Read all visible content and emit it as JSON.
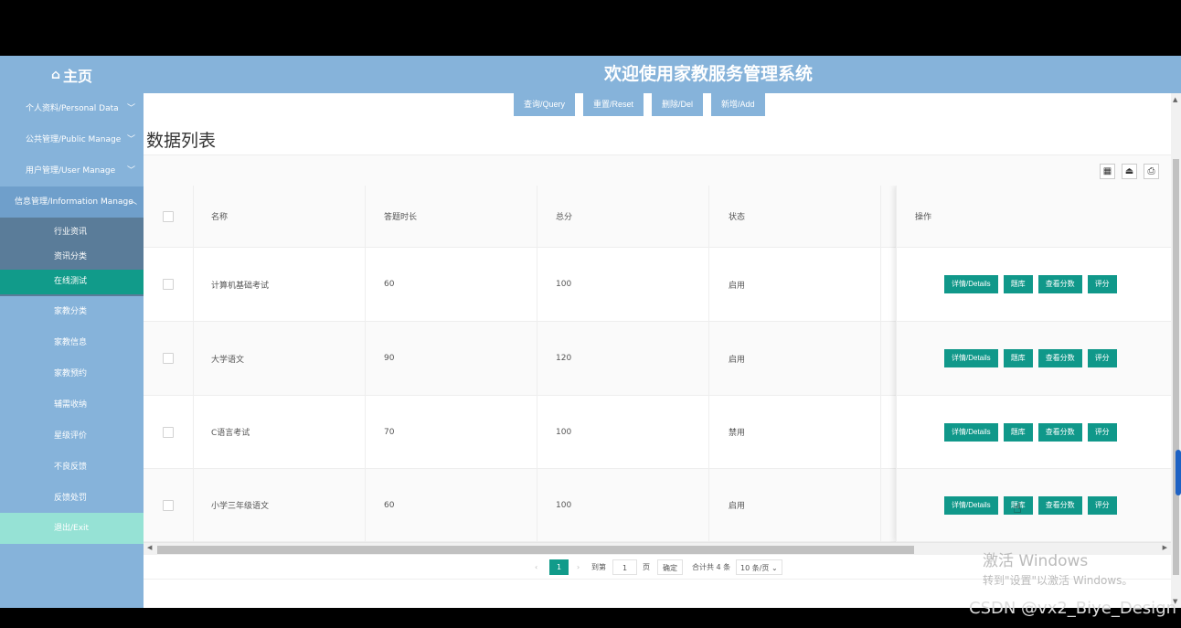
{
  "header": {
    "home_label": "主页",
    "home_icon": "home-icon",
    "system_title": "欢迎使用家教服务管理系统"
  },
  "sidebar": {
    "menus": [
      {
        "label": "个人资料/Personal Data"
      },
      {
        "label": "公共管理/Public Manage"
      },
      {
        "label": "用户管理/User Manage"
      },
      {
        "label": "信息管理/Information Manage"
      }
    ],
    "submenu": [
      {
        "label": "行业资讯"
      },
      {
        "label": "资讯分类"
      },
      {
        "label": "在线测试"
      }
    ],
    "links": [
      {
        "label": "家教分类"
      },
      {
        "label": "家教信息"
      },
      {
        "label": "家教预约"
      },
      {
        "label": "辅需收纳"
      },
      {
        "label": "星级评价"
      },
      {
        "label": "不良反馈"
      },
      {
        "label": "反馈处罚"
      }
    ],
    "exit_label": "退出/Exit"
  },
  "toolbar": {
    "query": "查询/Query",
    "reset": "重置/Reset",
    "delete": "删除/Del",
    "add": "新增/Add"
  },
  "list_title": "数据列表",
  "table": {
    "headers": [
      "名称",
      "答题时长",
      "总分",
      "状态",
      "操作"
    ],
    "rows": [
      {
        "name": "计算机基础考试",
        "duration": "60",
        "score": "100",
        "status": "启用"
      },
      {
        "name": "大学语文",
        "duration": "90",
        "score": "120",
        "status": "启用"
      },
      {
        "name": "C语言考试",
        "duration": "70",
        "score": "100",
        "status": "禁用"
      },
      {
        "name": "小学三年级语文",
        "duration": "60",
        "score": "100",
        "status": "启用"
      }
    ],
    "actions": {
      "details": "详情/Details",
      "bank": "题库",
      "view_score": "查看分数",
      "grade": "评分"
    }
  },
  "pagination": {
    "current_page": "1",
    "goto_label": "到第",
    "goto_value": "1",
    "page_unit": "页",
    "confirm": "确定",
    "total": "合计共 4 条",
    "page_size": "10 条/页"
  },
  "watermark": {
    "line1": "激活 Windows",
    "line2": "转到\"设置\"以激活 Windows。"
  },
  "credit": "CSDN @vx2_Biye_Design",
  "colors": {
    "brand_blue": "#86b3da",
    "teal": "#10988a",
    "exit_mint": "#96e2d5"
  }
}
